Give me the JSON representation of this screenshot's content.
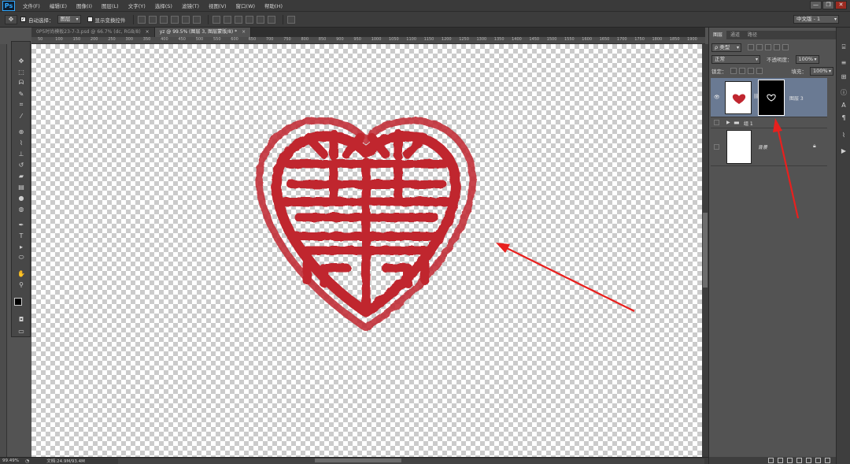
{
  "app": {
    "logo": "Ps",
    "menu": [
      "文件(F)",
      "编辑(E)",
      "图像(I)",
      "图层(L)",
      "文字(Y)",
      "选择(S)",
      "滤镜(T)",
      "视图(V)",
      "窗口(W)",
      "帮助(H)"
    ],
    "window_controls": [
      "—",
      "❐",
      "✕"
    ]
  },
  "options_bar": {
    "auto_select_label": "自动选择：",
    "auto_select_target": "图层",
    "show_transform_label": "显示变换控件",
    "workspace": "中文版 - 1"
  },
  "tabs": [
    {
      "label": "0P5时尚模板23-7-3.psd @ 66.7% (dc, RGB/8)",
      "close": "×",
      "active": false
    },
    {
      "label": "yz @ 99.5% (图层 3, 图层蒙版/8) *",
      "close": "×",
      "active": true
    }
  ],
  "ruler_top": [
    "50",
    "100",
    "150",
    "200",
    "250",
    "300",
    "350",
    "400",
    "450",
    "500",
    "550",
    "600",
    "650",
    "700",
    "750",
    "800",
    "850",
    "900",
    "950",
    "1000",
    "1050",
    "1100",
    "1150",
    "1200",
    "1250",
    "1300",
    "1350",
    "1400",
    "1450",
    "1500",
    "1550",
    "1600",
    "1650",
    "1700",
    "1750",
    "1800",
    "1850",
    "1900"
  ],
  "statusbar": {
    "zoom": "99.49%",
    "doc": "文档:24.9M/93.4M"
  },
  "layers_panel": {
    "tabs": [
      "图层",
      "通道",
      "路径"
    ],
    "filter_kind": "ρ 类型",
    "blend_mode": "正常",
    "opacity_label": "不透明度：",
    "opacity": "100%",
    "lock_label": "锁定：",
    "fill_label": "填充：",
    "fill": "100%",
    "layers": [
      {
        "name": "图层 3",
        "selected": true,
        "has_mask": true
      },
      {
        "name": "组 1",
        "selected": false,
        "is_group": true
      },
      {
        "name": "背景",
        "selected": false,
        "locked": true
      }
    ]
  },
  "colors": {
    "seal_red": "#c0262f",
    "arrow_red": "#e8201e",
    "selection_blue": "#6a7a93"
  }
}
